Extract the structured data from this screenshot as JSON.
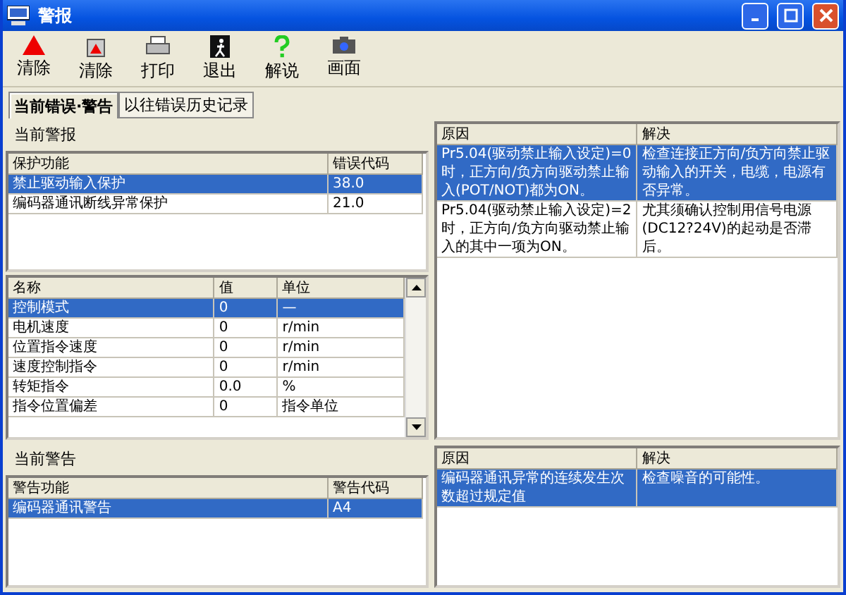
{
  "window": {
    "title": "警报"
  },
  "toolbar": [
    {
      "kind": "triangle",
      "label": "清除"
    },
    {
      "kind": "box",
      "label": "清除"
    },
    {
      "kind": "printer",
      "label": "打印"
    },
    {
      "kind": "exit",
      "label": "退出"
    },
    {
      "kind": "help",
      "label": "解说"
    },
    {
      "kind": "camera",
      "label": "画面"
    }
  ],
  "tabs": [
    {
      "label": "当前错误·警告",
      "selected": true
    },
    {
      "label": "以往错误历史记录",
      "selected": false
    }
  ],
  "alarm": {
    "title": "当前警报",
    "columns": [
      "保护功能",
      "错误代码"
    ],
    "rows": [
      {
        "function": "禁止驱动输入保护",
        "code": "38.0",
        "selected": true
      },
      {
        "function": "编码器通讯断线异常保护",
        "code": "21.0",
        "selected": false
      }
    ]
  },
  "params": {
    "columns": [
      "名称",
      "值",
      "单位"
    ],
    "rows": [
      {
        "name": "控制模式",
        "value": "0",
        "unit": "—",
        "selected": true
      },
      {
        "name": "电机速度",
        "value": "0",
        "unit": "r/min",
        "selected": false
      },
      {
        "name": "位置指令速度",
        "value": "0",
        "unit": "r/min",
        "selected": false
      },
      {
        "name": "速度控制指令",
        "value": "0",
        "unit": "r/min",
        "selected": false
      },
      {
        "name": "转矩指令",
        "value": "0.0",
        "unit": "%",
        "selected": false
      },
      {
        "name": "指令位置偏差",
        "value": "0",
        "unit": "指令单位",
        "selected": false
      }
    ]
  },
  "alarm_causes": {
    "columns": [
      "原因",
      "解决"
    ],
    "rows": [
      {
        "cause": "Pr5.04(驱动禁止输入设定)=0时，正方向/负方向驱动禁止输入(POT/NOT)都为ON。",
        "solution": "检查连接正方向/负方向禁止驱动输入的开关，电缆，电源有否异常。",
        "selected": true
      },
      {
        "cause": "Pr5.04(驱动禁止输入设定)=2时，正方向/负方向驱动禁止输入的其中一项为ON。",
        "solution": "尤其须确认控制用信号电源(DC12?24V)的起动是否滞后。",
        "selected": false
      }
    ]
  },
  "warning": {
    "title": "当前警告",
    "columns": [
      "警告功能",
      "警告代码"
    ],
    "rows": [
      {
        "function": "编码器通讯警告",
        "code": "A4",
        "selected": true
      }
    ]
  },
  "warning_causes": {
    "columns": [
      "原因",
      "解决"
    ],
    "rows": [
      {
        "cause": "编码器通讯异常的连续发生次数超过规定值",
        "solution": "检查噪音的可能性。",
        "selected": true
      }
    ]
  }
}
